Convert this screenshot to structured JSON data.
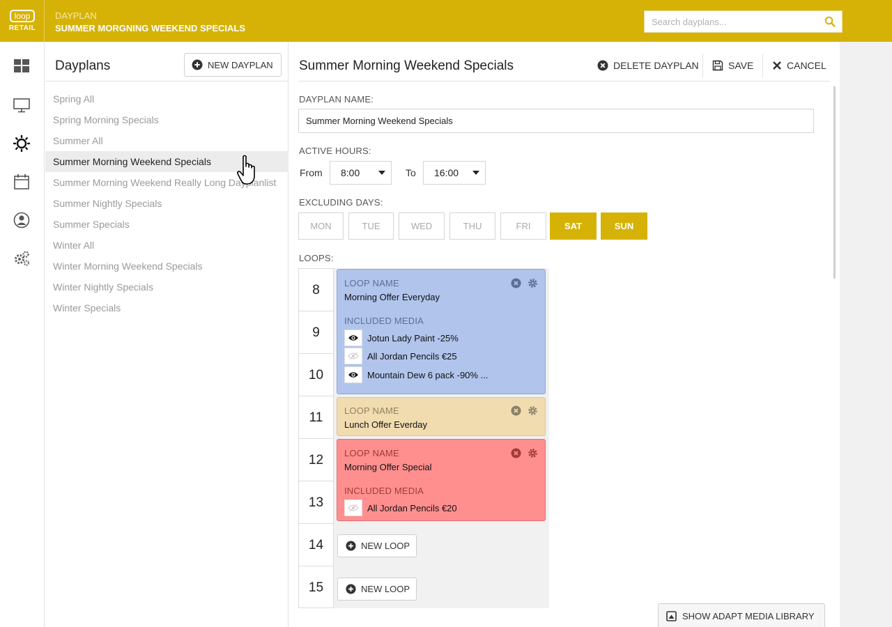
{
  "brand": {
    "logo_text": "loop",
    "logo_sub": "RETAIL",
    "color": "#d6b206"
  },
  "header": {
    "section": "DAYPLAN",
    "title": "SUMMER MORGNING WEEKEND SPECIALS"
  },
  "search": {
    "placeholder": "Search dayplans...",
    "icon": "search-icon"
  },
  "nav": {
    "items": [
      {
        "icon": "dashboard-icon"
      },
      {
        "icon": "monitor-icon"
      },
      {
        "icon": "sun-icon",
        "active": true
      },
      {
        "icon": "calendar-icon"
      },
      {
        "icon": "user-icon"
      },
      {
        "icon": "gears-icon"
      }
    ]
  },
  "dayplans": {
    "title": "Dayplans",
    "new_label": "NEW DAYPLAN",
    "items": [
      "Spring All",
      "Spring Morning Specials",
      "Summer All",
      "Summer Morning Weekend Specials",
      "Summer Morning Weekend Really Long Dayplanlist",
      "Summer Nightly Specials",
      "Summer Specials",
      "Winter All",
      "Winter Morning Weekend Specials",
      "Winter Nightly Specials",
      "Winter Specials"
    ],
    "selected": "Summer Morning Weekend Specials"
  },
  "detail": {
    "title": "Summer Morning Weekend Specials",
    "actions": {
      "delete": "DELETE DAYPLAN",
      "save": "SAVE",
      "cancel": "CANCEL"
    },
    "name_label": "DAYPLAN NAME:",
    "name_value": "Summer Morning Weekend Specials",
    "hours_label": "ACTIVE HOURS:",
    "from_label": "From",
    "from_value": "8:00",
    "to_label": "To",
    "to_value": "16:00",
    "excluding_label": "EXCLUDING DAYS:",
    "days": [
      {
        "label": "MON",
        "selected": false
      },
      {
        "label": "TUE",
        "selected": false
      },
      {
        "label": "WED",
        "selected": false
      },
      {
        "label": "THU",
        "selected": false
      },
      {
        "label": "FRI",
        "selected": false
      },
      {
        "label": "SAT",
        "selected": true
      },
      {
        "label": "SUN",
        "selected": true
      }
    ],
    "loops_label": "LOOPS:",
    "hours": [
      "8",
      "9",
      "10",
      "11",
      "12",
      "13",
      "14",
      "15"
    ],
    "loop_name_label": "LOOP NAME",
    "included_media_label": "INCLUDED MEDIA",
    "loops": [
      {
        "name": "Morning Offer Everyday",
        "color": "#b0c4ec",
        "media": [
          {
            "name": "Jotun Lady Paint -25%",
            "visible": true
          },
          {
            "name": "All Jordan Pencils €25",
            "visible": false
          },
          {
            "name": "Mountain Dew 6 pack -90% ...",
            "visible": true
          }
        ]
      },
      {
        "name": "Lunch Offer Everday",
        "color": "#f1dcb0",
        "media": []
      },
      {
        "name": "Morning Offer Special",
        "color": "#ff8f8f",
        "media": [
          {
            "name": "All Jordan Pencils €20",
            "visible": false
          }
        ]
      }
    ],
    "new_loop_label": "NEW LOOP",
    "media_library_label": "SHOW ADAPT MEDIA LIBRARY"
  }
}
